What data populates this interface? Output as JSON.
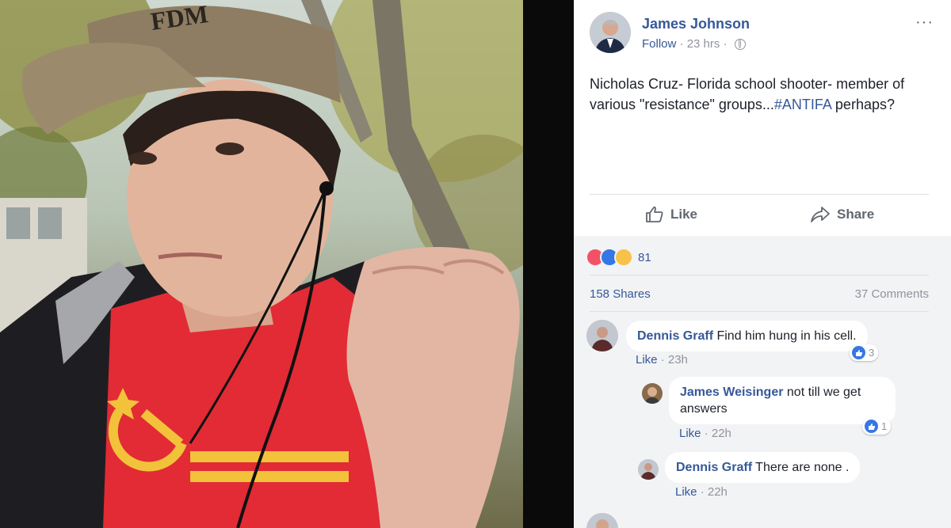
{
  "post": {
    "author": "James Johnson",
    "follow_label": "Follow",
    "timestamp": "23 hrs",
    "separator": " · ",
    "more_label": "···",
    "text_main": "Nicholas Cruz- Florida school shooter- member of various \"resistance\" groups...",
    "hashtag": "#ANTIFA",
    "text_end": " perhaps?",
    "like_label": "Like",
    "share_label": "Share",
    "reaction_count": "81",
    "shares_label": "158 Shares",
    "comments_label": "37 Comments",
    "reaction_icons": [
      "angry-icon",
      "like-icon",
      "sad-icon"
    ],
    "accent_color": "#365899"
  },
  "comments": [
    {
      "name": "Dennis Graff",
      "text": "Find him hung in his cell.",
      "like_label": "Like",
      "time": "23h",
      "likes": "3"
    },
    {
      "name": "James Weisinger",
      "text": "not till we get answers",
      "like_label": "Like",
      "time": "22h",
      "likes": "1"
    },
    {
      "name": "Dennis Graff",
      "text": "There are none .",
      "like_label": "Like",
      "time": "22h"
    }
  ],
  "photo": {
    "cap_text": "FDM"
  }
}
